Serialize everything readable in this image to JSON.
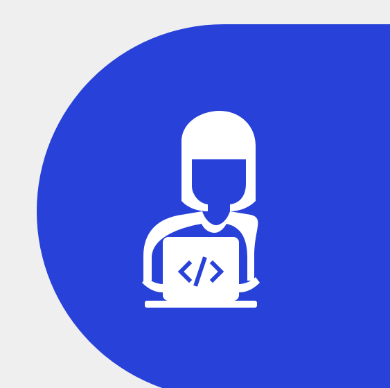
{
  "colors": {
    "background": "#efefef",
    "shape": "#2741d9",
    "icon": "#ffffff"
  },
  "icons": {
    "main": "developer-laptop-icon",
    "code": "code-brackets-icon"
  }
}
